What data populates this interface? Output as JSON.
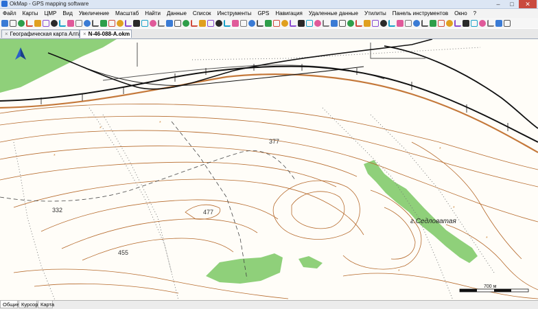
{
  "window": {
    "title": "OkMap - GPS mapping software",
    "minimize": "–",
    "maximize": "□",
    "close": "✕"
  },
  "menu": [
    "Файл",
    "Карты",
    "ЦМР",
    "Вид",
    "Увеличение",
    "Масштаб",
    "Найти",
    "Данные",
    "Список",
    "Инструменты",
    "GPS",
    "Навигация",
    "Удаленные данные",
    "Утилиты",
    "Панель инструментов",
    "Окно",
    "?"
  ],
  "tabs": {
    "map1": "Географическая карта Алта...",
    "map2": "N-46-088-A.okm",
    "close_glyph": "×"
  },
  "map": {
    "elevations": {
      "e377": "377",
      "e477": "477",
      "e332": "332",
      "e455": "455"
    },
    "peak_name": "г.Седловатая",
    "scale_label": "700 м",
    "colors": {
      "contour": "#b5692b",
      "forest": "#8fd07a",
      "rail": "#111111",
      "road": "#c4783a"
    }
  },
  "status_tabs": [
    "Общие",
    "Курсор",
    "Карта"
  ]
}
